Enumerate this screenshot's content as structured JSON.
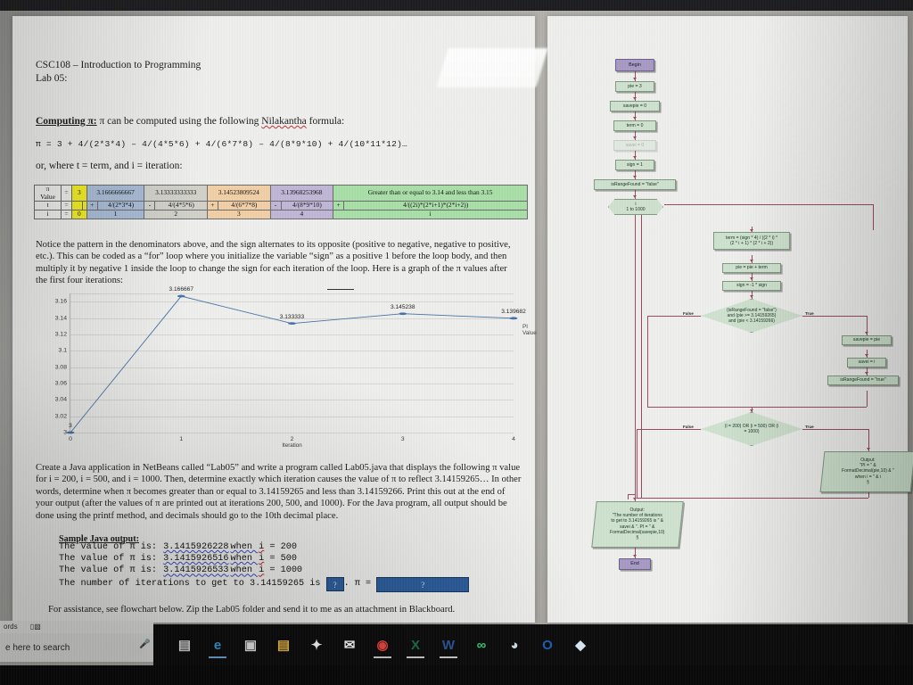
{
  "document": {
    "course_header": "CSC108 – Introduction to Programming",
    "lab_header": "Lab 05:",
    "section_title": "Computing π:",
    "section_intro_a": " π can be computed using the following ",
    "section_intro_b": "Nilakantha",
    "section_intro_c": " formula:",
    "formula": "π  =   3 + 4/(2*3*4)  –  4/(4*5*6)  +  4/(6*7*8)  –  4/(8*9*10)  +  4/(10*11*12)…",
    "or_where": "or, where t = term, and i = iteration:",
    "paragraph_notice": "Notice the pattern in the denominators above, and the sign alternates to its opposite (positive to negative, negative to positive, etc.).  This can be coded as a “for” loop where you initialize the variable “sign” as a positive 1 before the loop body, and then multiply it by negative 1 inside the loop to change the sign for each iteration of the loop.  Here is a graph of the π values after the first four iterations:",
    "paragraph_assignment": "Create a Java application in NetBeans called “Lab05” and write a program called Lab05.java that displays the following π value for i = 200, i = 500, and i = 1000.  Then, determine exactly which iteration causes the value of π to reflect 3.14159265…  In other words, determine when π becomes greater than or equal to 3.14159265 and less than 3.14159266.  Print this out at the end of your output (after the values of π are printed out at iterations 200, 500, and 1000).  For the Java program, all output should be done using the printf method, and decimals should go to the 10th decimal place.",
    "sample_header": "Sample Java output:",
    "sample_lines": [
      {
        "prefix": "The value of π is: ",
        "value": "3.1415926228",
        "mid": "when ",
        "ivar": "i",
        "suffix": " = 200"
      },
      {
        "prefix": "The value of π is: ",
        "value": "3.1415926516",
        "mid": "when ",
        "ivar": "i",
        "suffix": " = 500"
      },
      {
        "prefix": "The value of π is: ",
        "value": "3.1415926533",
        "mid": "when ",
        "ivar": "i",
        "suffix": " = 1000"
      }
    ],
    "sample_last_prefix": "The number of iterations to get to 3.14159265 is",
    "answer_box_1": "?",
    "sample_last_mid": ".  π = ",
    "answer_box_2": "?",
    "assistance": "For assistance, see flowchart below.  Zip the Lab05 folder and send it to me as an attachment in Blackboard."
  },
  "table": {
    "rows": [
      {
        "label": "π\nValue",
        "label_line1": "π",
        "label_line2": "Value",
        "eq": "=",
        "cells": [
          "3",
          "3.1666666667",
          "3.13333333333",
          "3.14523809524",
          "3.13968253968",
          "Greater than or equal to 3.14 and less than 3.15"
        ]
      },
      {
        "label": "t",
        "eq": "=",
        "signs": [
          "",
          "+",
          "-",
          "+",
          "-",
          "+"
        ],
        "cells": [
          "",
          "4/(2*3*4)",
          "4/(4*5*6)",
          "4/(6*7*8)",
          "4/(8*9*10)",
          "4/((2i)*(2*i+1)*(2*i+2))"
        ]
      },
      {
        "label": "i",
        "eq": "=",
        "cells": [
          "0",
          "1",
          "2",
          "3",
          "4",
          "i"
        ]
      }
    ],
    "colors": {
      "yellow": "#f2ee24",
      "blue": "#a9bdd7",
      "gray": "#d2d2cb",
      "orange": "#f2cfa6",
      "purple": "#c0b7d8",
      "green": "#a9dfa9"
    }
  },
  "chart_data": {
    "type": "line",
    "title": "",
    "xlabel": "Iteration",
    "ylabel": "",
    "series_name": "PI Value",
    "x": [
      0,
      1,
      2,
      3,
      4
    ],
    "xtick_labels": [
      "0",
      "1",
      "2",
      "3",
      "4"
    ],
    "values": [
      3,
      3.166667,
      3.133333,
      3.145238,
      3.139682
    ],
    "point_labels": [
      "3",
      "3.166667",
      "3.133333",
      "3.145238",
      "3.139682"
    ],
    "ytick_labels": [
      "3",
      "3.02",
      "3.04",
      "3.06",
      "3.08",
      "3.1",
      "3.12",
      "3.14",
      "3.16"
    ],
    "ylim": [
      3,
      3.17
    ],
    "xlim": [
      0,
      4
    ],
    "grid": true,
    "legend_position": "right",
    "line_color": "#4472a8"
  },
  "flowchart": {
    "nodes": {
      "begin": "Begin",
      "pie_init": "pie = 3",
      "savepie_init": "savepie = 0",
      "term_init": "term = 0",
      "hidden_init": "savei = 0",
      "sign_init": "sign = 1",
      "range_init": "isRangeFound = \"false\"",
      "loop": "i\n1 to 1000",
      "loop_line1": "i",
      "loop_line2": "1 to 1000",
      "term_calc_l1": "term = (sign * 4) / ((2 * i) *",
      "term_calc_l2": "(2 * i + 1) * (2 * i + 2))",
      "pie_accum": "pie = pie + term",
      "sign_flip": "sign = -1 * sign",
      "decision1_l1": "(isRangeFound = \"false\")",
      "decision1_l2": "and (pie >= 3.14159265)",
      "decision1_l3": "and (pie < 3.14159266)",
      "savepie_assign": "savepie = pie",
      "savei_assign": "savei = i",
      "range_true": "isRangeFound = \"true\"",
      "decision2_l1": "(i = 200) OR (i = 500) OR (i",
      "decision2_l2": "= 1000)",
      "output1_l1": "Output:",
      "output1_l2": "\"PI = \" &",
      "output1_l3": "FormatDecimal(pie,10) & \"",
      "output1_l4": "when i = \" & i",
      "output1_l5": "§",
      "output2_l1": "Output:",
      "output2_l2": "\"The number of iterations",
      "output2_l3": "to get to 3.14159265 is \" &",
      "output2_l4": "savei & \".  PI = \" &",
      "output2_l5": "FormatDecimal(savepie,10)",
      "output2_l6": "§",
      "end": "End"
    },
    "branch_labels": {
      "false1": "False",
      "true1": "True",
      "false2": "False",
      "true2": "True"
    },
    "colors": {
      "process": "#cfe2cf",
      "terminator": "#a79ac4",
      "connector": "#9b4a5c"
    }
  },
  "taskbar": {
    "word_status": "ords",
    "search_placeholder": "e here to search",
    "items": [
      {
        "name": "task-view-icon",
        "glyph": "▤"
      },
      {
        "name": "edge-icon",
        "glyph": "e"
      },
      {
        "name": "microsoft-store-icon",
        "glyph": "▣"
      },
      {
        "name": "file-explorer-icon",
        "glyph": "▤"
      },
      {
        "name": "dropbox-icon",
        "glyph": "✦"
      },
      {
        "name": "mail-icon",
        "glyph": "✉"
      },
      {
        "name": "chrome-icon",
        "glyph": "◉"
      },
      {
        "name": "excel-icon",
        "glyph": "X"
      },
      {
        "name": "word-icon",
        "glyph": "W"
      },
      {
        "name": "office-lens-icon",
        "glyph": "∞"
      },
      {
        "name": "media-player-icon",
        "glyph": "◕"
      },
      {
        "name": "outlook-icon",
        "glyph": "O"
      },
      {
        "name": "netbeans-icon",
        "glyph": "◆"
      }
    ]
  }
}
